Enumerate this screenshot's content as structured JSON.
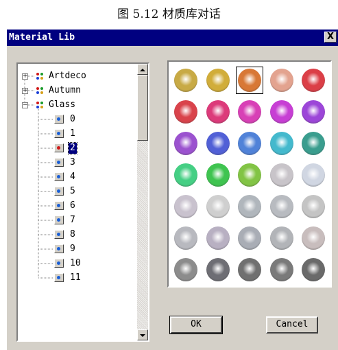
{
  "caption": "图 5.12   材质库对话",
  "window": {
    "title": "Material Lib",
    "close_label": "X"
  },
  "tree": {
    "groups": [
      "Artdeco",
      "Autumn",
      "Glass"
    ],
    "items": [
      "0",
      "1",
      "2",
      "3",
      "4",
      "5",
      "6",
      "7",
      "8",
      "9",
      "10",
      "11"
    ],
    "selected_item": "2"
  },
  "materials": [
    [
      "#c8aa45",
      "#d1ad3a",
      "#d87836",
      "#e3a38f",
      "#db3f47"
    ],
    [
      "#d9434b",
      "#dc3a7a",
      "#d840b6",
      "#c73ed4",
      "#9c46d8"
    ],
    [
      "#9b52cf",
      "#5160d6",
      "#5082d8",
      "#44b9cd",
      "#3a9d8e"
    ],
    [
      "#45cf84",
      "#3fc450",
      "#82c445",
      "#c8c4c9",
      "#d0d6e2"
    ],
    [
      "#c9c2ce",
      "#cfcfcf",
      "#b0b6bc",
      "#b8bbc0",
      "#c4c4c4"
    ],
    [
      "#b8b9bf",
      "#b8b0c2",
      "#a9adb5",
      "#b2b4b8",
      "#c8bdbd"
    ],
    [
      "#8c8c8c",
      "#6e6e74",
      "#707070",
      "#7a7a7a",
      "#6a6a6a"
    ]
  ],
  "selected_material_index": 2,
  "buttons": {
    "ok": "OK",
    "cancel": "Cancel"
  }
}
